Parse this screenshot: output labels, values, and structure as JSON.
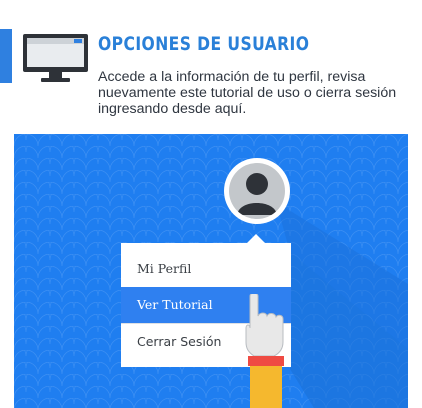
{
  "header": {
    "title": "OPCIONES DE USUARIO",
    "description": "Accede a la información de tu perfil, revisa nuevamente este tutorial de uso o cierra sesión ingresando desde aquí.",
    "icon": "monitor-icon"
  },
  "illustration": {
    "avatar_icon": "user-avatar-icon",
    "menu": {
      "items": [
        {
          "label": "Mi Perfil"
        },
        {
          "label": "Ver Tutorial",
          "highlighted": true
        },
        {
          "label": "Cerrar Sesión"
        }
      ]
    },
    "pointer_icon": "pointing-hand-icon"
  },
  "colors": {
    "accent": "#2a80d8",
    "panel_bg": "#1f7ef0",
    "highlight": "#2f80f0",
    "text": "#2f3640"
  }
}
